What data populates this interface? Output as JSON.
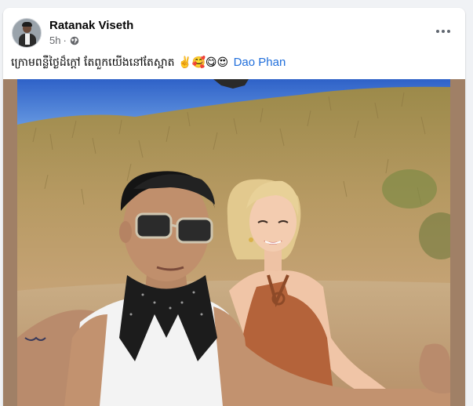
{
  "post": {
    "author_name": "Ratanak Viseth",
    "time": "5h",
    "separator": "·",
    "privacy_icon": "globe-icon",
    "more_icon": "more-options-icon",
    "caption_text": "ក្រោមពន្លឺថ្ងៃដ៏ក្តៅ តែពួកយើងនៅតែស្អាត",
    "caption_emojis": [
      "✌️",
      "🥰",
      "😋",
      "😍"
    ],
    "tagged_user": "Dao Phan",
    "photo_description_icon": "photo"
  },
  "colors": {
    "link": "#216fdb",
    "author": "#050505",
    "meta": "#65676b",
    "frame": "#a08066"
  }
}
